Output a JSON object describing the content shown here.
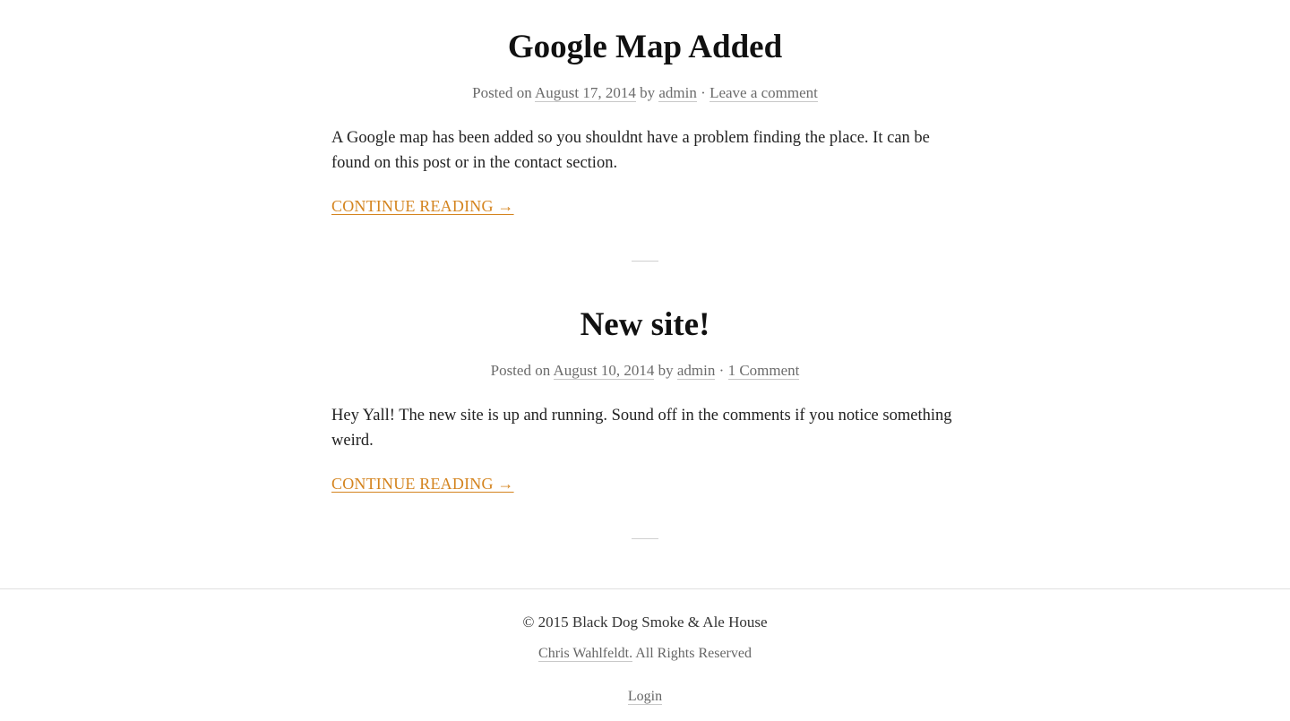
{
  "posts": [
    {
      "title": "Google Map Added",
      "meta": {
        "posted_on": "Posted on",
        "date": "August 17, 2014",
        "by": "by",
        "author": "admin",
        "separator": "·",
        "comments": "Leave a comment"
      },
      "excerpt": "A Google map has been added so you shouldnt have a problem finding the place. It can be found on this post or in the contact section.",
      "continue_label": "CONTINUE READING →"
    },
    {
      "title": "New site!",
      "meta": {
        "posted_on": "Posted on",
        "date": "August 10, 2014",
        "by": "by",
        "author": "admin",
        "separator": "·",
        "comments": "1 Comment"
      },
      "excerpt": "Hey Yall! The new site is up and running. Sound off in the comments if you notice something weird.",
      "continue_label": "CONTINUE READING →"
    }
  ],
  "footer": {
    "copyright": "© 2015 Black Dog Smoke & Ale House",
    "credit_link": "Chris Wahlfeldt.",
    "credit_text": " All Rights Reserved",
    "login": "Login"
  },
  "colors": {
    "accent": "#d4841f",
    "meta_text": "#6b6b6b",
    "body_text": "#222222"
  }
}
